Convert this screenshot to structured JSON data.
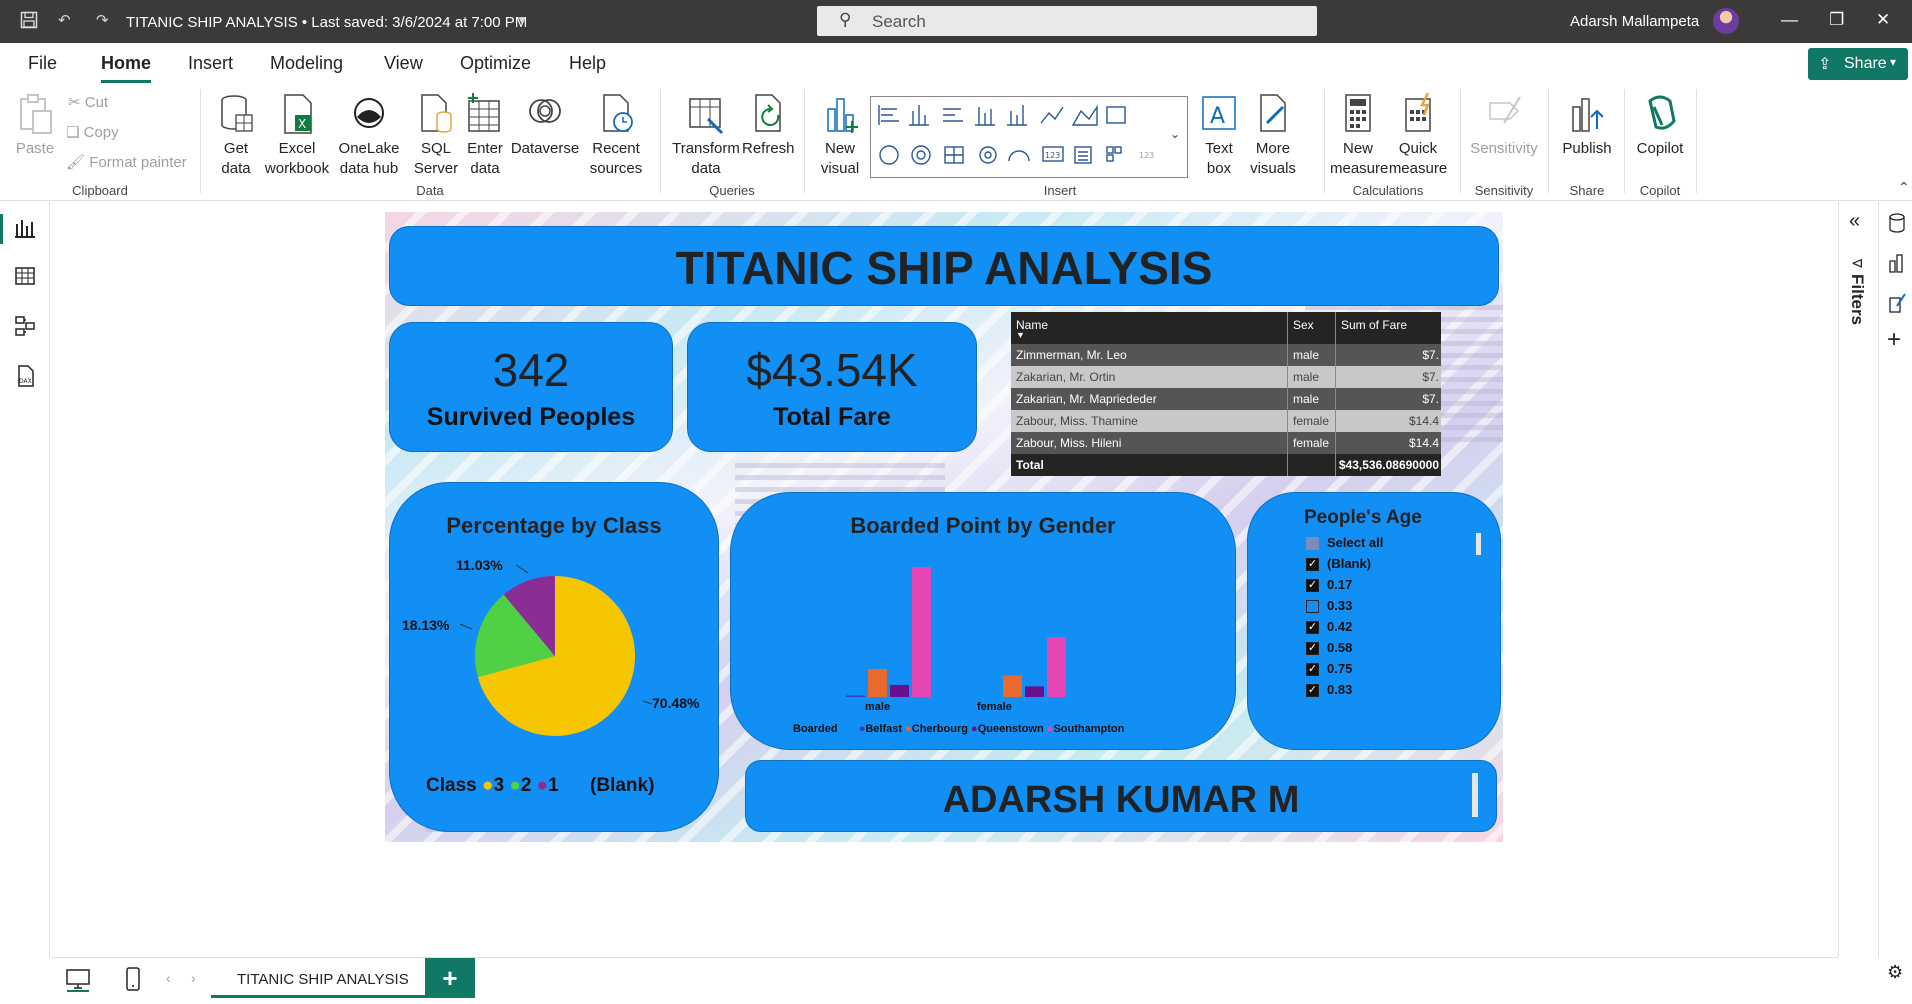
{
  "titlebar": {
    "doc_title": "TITANIC SHIP ANALYSIS  •  Last saved: 3/6/2024 at 7:00 PM",
    "search_placeholder": "Search",
    "user_name": "Adarsh Mallampeta"
  },
  "menu": {
    "tabs": [
      "File",
      "Home",
      "Insert",
      "Modeling",
      "View",
      "Optimize",
      "Help"
    ],
    "active": "Home",
    "share_label": "Share"
  },
  "ribbon": {
    "clipboard": {
      "paste": "Paste",
      "cut": "Cut",
      "copy": "Copy",
      "format_painter": "Format painter",
      "group": "Clipboard"
    },
    "data": {
      "get_data": "Get\ndata",
      "excel": "Excel\nworkbook",
      "onelake": "OneLake\ndata hub",
      "sql": "SQL\nServer",
      "enter": "Enter\ndata",
      "dataverse": "Dataverse",
      "recent": "Recent\nsources",
      "group": "Data"
    },
    "queries": {
      "transform": "Transform\ndata",
      "refresh": "Refresh",
      "group": "Queries"
    },
    "insert": {
      "new_visual": "New\nvisual",
      "text_box": "Text\nbox",
      "more_visuals": "More\nvisuals",
      "group": "Insert"
    },
    "calculations": {
      "new_measure": "New\nmeasure",
      "quick_measure": "Quick\nmeasure",
      "group": "Calculations"
    },
    "sensitivity": {
      "label": "Sensitivity",
      "group": "Sensitivity"
    },
    "share": {
      "publish": "Publish",
      "group": "Share"
    },
    "copilot": {
      "label": "Copilot",
      "group": "Copilot"
    }
  },
  "right_pane": {
    "filters_label": "Filters"
  },
  "bottom": {
    "page_tab": "TITANIC SHIP ANALYSIS",
    "add_label": "+"
  },
  "report": {
    "title": "TITANIC SHIP ANALYSIS",
    "kpi_survived": {
      "value": "342",
      "label": "Survived Peoples"
    },
    "kpi_fare": {
      "value": "$43.54K",
      "label": "Total Fare"
    },
    "table": {
      "headers": [
        "Name",
        "Sex",
        "Sum of Fare"
      ],
      "rows": [
        [
          "Zimmerman, Mr. Leo",
          "male",
          "$7."
        ],
        [
          "Zakarian, Mr. Ortin",
          "male",
          "$7."
        ],
        [
          "Zakarian, Mr. Mapriededer",
          "male",
          "$7."
        ],
        [
          "Zabour, Miss. Thamine",
          "female",
          "$14.4"
        ],
        [
          "Zabour, Miss. Hileni",
          "female",
          "$14.4"
        ]
      ],
      "total_label": "Total",
      "total_value": "$43,536.08690000"
    },
    "pie": {
      "title": "Percentage by Class",
      "legend_title": "Class",
      "legend": [
        {
          "label": "3",
          "color": "#f6c700"
        },
        {
          "label": "2",
          "color": "#50d045"
        },
        {
          "label": "1",
          "color": "#8a2d95"
        },
        {
          "label": "(Blank)",
          "color": null
        }
      ],
      "labels": {
        "p3": "70.48%",
        "p2": "18.13%",
        "p1": "11.03%"
      }
    },
    "bar": {
      "title": "Boarded Point by Gender",
      "legend_title": "Boarded",
      "legend": [
        {
          "label": "Belfast",
          "color": "#2a3ed6"
        },
        {
          "label": "Cherbourg",
          "color": "#e86a2c"
        },
        {
          "label": "Queenstown",
          "color": "#6b0f8f"
        },
        {
          "label": "Southampton",
          "color": "#e546b3"
        }
      ],
      "categories": [
        "male",
        "female"
      ]
    },
    "age_slicer": {
      "title": "People's Age",
      "items": [
        {
          "label": "Select all",
          "state": "partial"
        },
        {
          "label": "(Blank)",
          "state": "on"
        },
        {
          "label": "0.17",
          "state": "on"
        },
        {
          "label": "0.33",
          "state": "off"
        },
        {
          "label": "0.42",
          "state": "on"
        },
        {
          "label": "0.58",
          "state": "on"
        },
        {
          "label": "0.75",
          "state": "on"
        },
        {
          "label": "0.83",
          "state": "on"
        }
      ]
    },
    "author": "ADARSH KUMAR M"
  },
  "chart_data": [
    {
      "type": "pie",
      "title": "Percentage by Class",
      "categories": [
        "3",
        "2",
        "1"
      ],
      "values": [
        70.48,
        18.13,
        11.03
      ],
      "legend_title": "Class",
      "legend": [
        "3",
        "2",
        "1",
        "(Blank)"
      ],
      "colors": [
        "#f6c700",
        "#50d045",
        "#8a2d95"
      ]
    },
    {
      "type": "bar",
      "title": "Boarded Point by Gender",
      "categories": [
        "male",
        "female"
      ],
      "series": [
        {
          "name": "Belfast",
          "values": [
            1,
            0
          ]
        },
        {
          "name": "Cherbourg",
          "values": [
            95,
            73
          ]
        },
        {
          "name": "Queenstown",
          "values": [
            41,
            36
          ]
        },
        {
          "name": "Southampton",
          "values": [
            441,
            203
          ]
        }
      ],
      "legend_title": "Boarded",
      "legend": "bottom",
      "grid": false
    }
  ]
}
